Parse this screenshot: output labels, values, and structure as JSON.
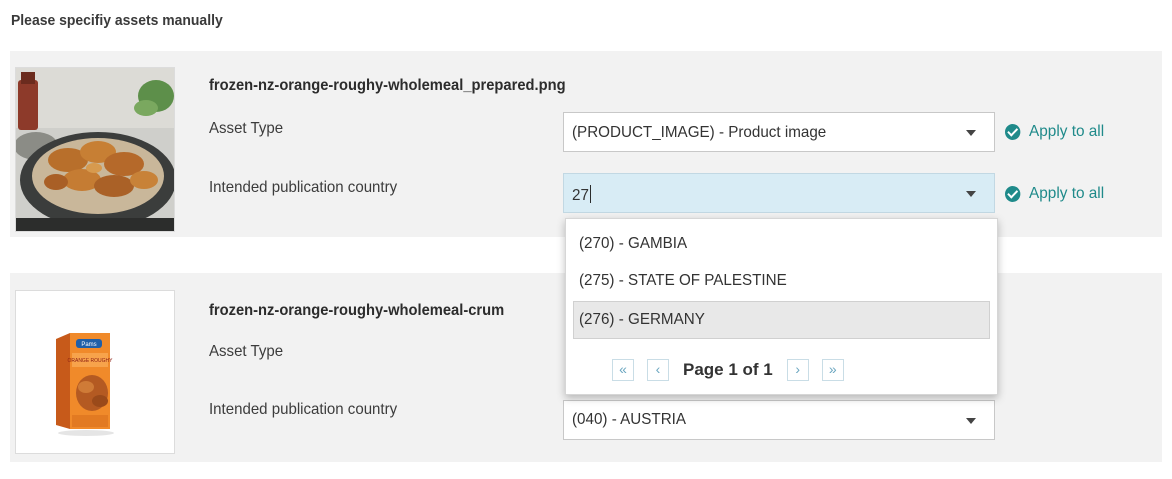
{
  "heading": "Please specifiy assets manually",
  "assets": [
    {
      "filename": "frozen-nz-orange-roughy-wholemeal_prepared.png",
      "asset_type_label": "Asset Type",
      "asset_type_value": "(PRODUCT_IMAGE) - Product image",
      "country_label": "Intended publication country",
      "country_input": "27",
      "apply_all": "Apply to all"
    },
    {
      "filename": "frozen-nz-orange-roughy-wholemeal-crum",
      "asset_type_label": "Asset Type",
      "country_label": "Intended publication country",
      "country_value": "(040) - AUSTRIA"
    }
  ],
  "dropdown": {
    "options": [
      "(270) - GAMBIA",
      "(275) - STATE OF PALESTINE",
      "(276) - GERMANY"
    ],
    "selected_index": 2,
    "pager": {
      "first": "«",
      "prev": "‹",
      "text": "Page 1 of 1",
      "next": "›",
      "last": "»"
    }
  },
  "package_brand": {
    "brand": "Pams",
    "product": "ORANGE ROUGHY"
  },
  "colors": {
    "accent": "#1f8a8a",
    "card_bg": "#f2f2f2",
    "focused_input": "#d8ecf5"
  }
}
